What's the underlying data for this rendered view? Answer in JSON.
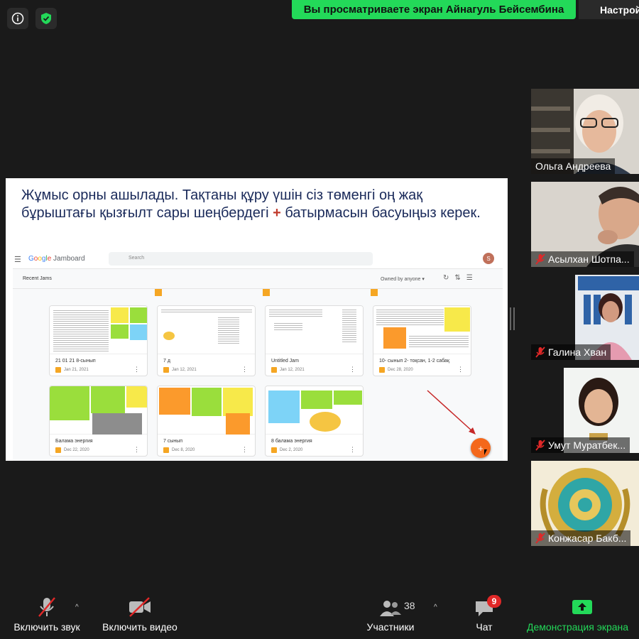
{
  "top_bar": {
    "share_banner": "Вы просматриваете экран Айнагуль Бейсембина",
    "settings_label": "Настрой"
  },
  "slide": {
    "text_main": "Жұмыс орны ашылады. Тақтаны құру үшін сіз төменгі оң жақ бұрыштағы қызғылт сары шеңбердегі ",
    "text_plus": "+",
    "text_end": " батырмасын басуыңыз керек.",
    "jamboard": {
      "logo_google": "Google",
      "logo_product": "Jamboard",
      "search_placeholder": "Search",
      "avatar_letter": "S",
      "section_title": "Recent Jams",
      "owned_by": "Owned by anyone",
      "cards": [
        {
          "title": "21 01 21 8-сынып",
          "date": "Jan 21, 2021"
        },
        {
          "title": "7 д",
          "date": "Jan 12, 2021"
        },
        {
          "title": "Untitled Jam",
          "date": "Jan 12, 2021"
        },
        {
          "title": "10- сынып 2- тоқсан, 1-2 сабақ",
          "date": "Dec 28, 2020"
        },
        {
          "title": "Балама энергия",
          "date": "Dec 22, 2020"
        },
        {
          "title": "7 сынып",
          "date": "Dec 8, 2020"
        },
        {
          "title": "8 балама энергия",
          "date": "Dec 2, 2020"
        }
      ],
      "fab_label": "+"
    }
  },
  "participants": [
    {
      "name": "Ольга Андреева",
      "muted": false
    },
    {
      "name": "Асылхан Шотпа...",
      "muted": true
    },
    {
      "name": "Галина Хван",
      "muted": true
    },
    {
      "name": "Умут Муратбек...",
      "muted": true
    },
    {
      "name": "Конжасар Бакб...",
      "muted": true
    }
  ],
  "toolbar": {
    "audio_label": "Включить звук",
    "video_label": "Включить видео",
    "participants_label": "Участники",
    "participants_count": "38",
    "chat_label": "Чат",
    "chat_badge": "9",
    "share_label": "Демонстрация экрана"
  },
  "colors": {
    "share_banner": "#23d959",
    "share_icon": "#23d959",
    "fab": "#f4681b",
    "mute_red": "#e02828"
  }
}
